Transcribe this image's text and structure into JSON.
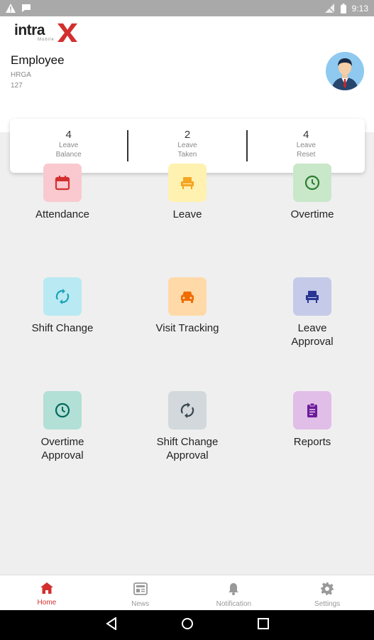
{
  "status_bar": {
    "time": "9:13"
  },
  "logo": {
    "word": "intra",
    "sub": "Mobile"
  },
  "employee": {
    "name": "Employee",
    "department": "HRGA",
    "id": "127"
  },
  "summary": [
    {
      "value": "4",
      "label_line1": "Leave",
      "label_line2": "Balance"
    },
    {
      "value": "2",
      "label_line1": "Leave",
      "label_line2": "Taken"
    },
    {
      "value": "4",
      "label_line1": "Leave",
      "label_line2": "Reset"
    }
  ],
  "menu": [
    {
      "label_line1": "Attendance",
      "label_line2": "",
      "icon": "calendar-icon",
      "bg": "#f9c9cf",
      "fg": "#d32f2f"
    },
    {
      "label_line1": "Leave",
      "label_line2": "",
      "icon": "chair-icon",
      "bg": "#fff1b0",
      "fg": "#f5a623"
    },
    {
      "label_line1": "Overtime",
      "label_line2": "",
      "icon": "clock-icon",
      "bg": "#c9e7c9",
      "fg": "#2e7d32"
    },
    {
      "label_line1": "Shift Change",
      "label_line2": "",
      "icon": "sync-icon",
      "bg": "#b9e9f2",
      "fg": "#1aa3b8"
    },
    {
      "label_line1": "Visit Tracking",
      "label_line2": "",
      "icon": "car-icon",
      "bg": "#ffd9a8",
      "fg": "#ef6c00"
    },
    {
      "label_line1": "Leave",
      "label_line2": "Approval",
      "icon": "chair-icon",
      "bg": "#c5cae9",
      "fg": "#283593"
    },
    {
      "label_line1": "Overtime",
      "label_line2": "Approval",
      "icon": "clock-icon",
      "bg": "#b2dfd6",
      "fg": "#00695c"
    },
    {
      "label_line1": "Shift Change",
      "label_line2": "Approval",
      "icon": "sync-icon",
      "bg": "#d2d8db",
      "fg": "#37474f"
    },
    {
      "label_line1": "Reports",
      "label_line2": "",
      "icon": "clipboard-icon",
      "bg": "#e1bee7",
      "fg": "#6a1b9a"
    }
  ],
  "bottom_nav": [
    {
      "label": "Home",
      "icon": "home-icon",
      "active": true
    },
    {
      "label": "News",
      "icon": "news-icon",
      "active": false
    },
    {
      "label": "Notification",
      "icon": "bell-icon",
      "active": false
    },
    {
      "label": "Settings",
      "icon": "gear-icon",
      "active": false
    }
  ],
  "colors": {
    "accent": "#d32f2f",
    "nav_inactive": "#999999"
  }
}
